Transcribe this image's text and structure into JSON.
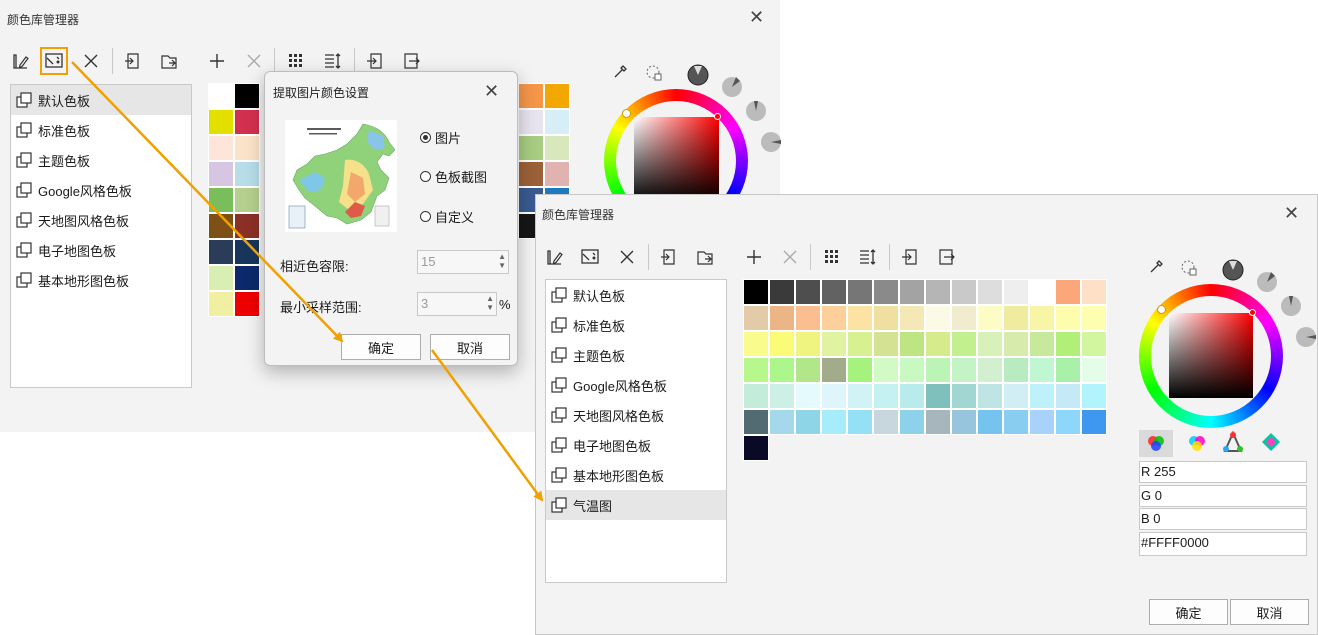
{
  "window1": {
    "title": "颜色库管理器",
    "close": "✕",
    "toolbar": [
      "edit",
      "extract-image",
      "delete",
      "import",
      "export",
      "add",
      "remove",
      "grid-view",
      "sort",
      "import-file",
      "export-file"
    ],
    "list": [
      {
        "label": "默认色板",
        "selected": true
      },
      {
        "label": "标准色板",
        "selected": false
      },
      {
        "label": "主题色板",
        "selected": false
      },
      {
        "label": "Google风格色板",
        "selected": false
      },
      {
        "label": "天地图风格色板",
        "selected": false
      },
      {
        "label": "电子地图色板",
        "selected": false
      },
      {
        "label": "基本地形图色板",
        "selected": false
      }
    ],
    "palette_left": [
      [
        "#ffffff",
        "#000000"
      ],
      [
        "#e3e000",
        "#d2304e"
      ],
      [
        "#fde6d9",
        "#fbe3c8"
      ],
      [
        "#d6c6e1",
        "#b6dde8"
      ],
      [
        "#79be5a",
        "#b4cf8e"
      ],
      [
        "#7d5016",
        "#8b3026"
      ],
      [
        "#2a3c58",
        "#18365c"
      ],
      [
        "#d8eeb2",
        "#0c2a6b"
      ],
      [
        "#f1efa2",
        "#ee0000"
      ]
    ],
    "palette_right": [
      [
        "#f59649",
        "#f2a800"
      ],
      [
        "#e7e3ef",
        "#d8eef6"
      ],
      [
        "#a7cc82",
        "#d9e8bc"
      ],
      [
        "#9b6138",
        "#e0b3b1"
      ],
      [
        "#395a90",
        "#1f79c0"
      ],
      [
        "#161616",
        "#bfbfbf"
      ]
    ]
  },
  "dialog": {
    "title": "提取图片颜色设置",
    "close": "✕",
    "options": [
      {
        "label": "图片",
        "selected": true
      },
      {
        "label": "色板截图",
        "selected": false
      },
      {
        "label": "自定义",
        "selected": false
      }
    ],
    "tolerance_label": "相近色容限:",
    "tolerance_value": "15",
    "sample_label": "最小采样范围:",
    "sample_value": "3",
    "sample_unit": "%",
    "ok": "确定",
    "cancel": "取消"
  },
  "window2": {
    "title": "颜色库管理器",
    "close": "✕",
    "list": [
      {
        "label": "默认色板",
        "selected": false
      },
      {
        "label": "标准色板",
        "selected": false
      },
      {
        "label": "主题色板",
        "selected": false
      },
      {
        "label": "Google风格色板",
        "selected": false
      },
      {
        "label": "天地图风格色板",
        "selected": false
      },
      {
        "label": "电子地图色板",
        "selected": false
      },
      {
        "label": "基本地形图色板",
        "selected": false
      },
      {
        "label": "气温图",
        "selected": true
      }
    ],
    "palette": [
      [
        "#000000",
        "#3a3a3a",
        "#4e4e4e",
        "#626262",
        "#767676",
        "#8a8a8a",
        "#a3a3a3",
        "#b5b5b5",
        "#c9c9c9",
        "#dddddd",
        "#eeeeee",
        "#ffffff",
        "#fca779",
        "#fde0c6"
      ],
      [
        "#e3caa9",
        "#ebb586",
        "#fbbe90",
        "#fdcf9a",
        "#fce3a3",
        "#efe0a1",
        "#f4e9b6",
        "#fbfae7",
        "#f0eccd",
        "#fdfbc6",
        "#efeb9f",
        "#f8f6a6",
        "#fdfdad",
        "#fefeb0"
      ],
      [
        "#f9fc8c",
        "#fafb77",
        "#eef47f",
        "#dff3a1",
        "#d7f191",
        "#d3e293",
        "#bde581",
        "#d6ec8c",
        "#c3f08f",
        "#d8f1b9",
        "#d7ebad",
        "#c7e99c",
        "#b2ef78",
        "#d2f6a0"
      ],
      [
        "#b7f78c",
        "#acf68c",
        "#b2e789",
        "#a2ab8a",
        "#a5f37d",
        "#d1fac5",
        "#c8f9c0",
        "#bcf4b6",
        "#c4f4c5",
        "#d2efcf",
        "#b9ebc1",
        "#c1f6d3",
        "#a9f1a8",
        "#e4fde8"
      ],
      [
        "#c4ecdb",
        "#cdf0e6",
        "#e4fafc",
        "#def5fb",
        "#d2f3f6",
        "#c6f1f2",
        "#b9ebec",
        "#7fbfbc",
        "#a2d6d2",
        "#bee4e4",
        "#d0eef4",
        "#bff1fb",
        "#c5e9f7",
        "#b2f4fe"
      ],
      [
        "#526b73",
        "#a6d8eb",
        "#8ed5e8",
        "#a6ecfd",
        "#94e0f4",
        "#c8d7dd",
        "#8ed1ea",
        "#a7b5bd",
        "#98c5de",
        "#74c4ed",
        "#89cdf1",
        "#a8d2f9",
        "#8ed6fa",
        "#3f98ef"
      ],
      [
        "#0a0a26"
      ]
    ],
    "rgb": {
      "r": "R 255",
      "g": "G 0",
      "b": "B 0",
      "hex": "#FFFF0000"
    },
    "ok": "确定",
    "cancel": "取消"
  },
  "colors": {
    "highlight": "#f0a000",
    "arrow": "#f0a000",
    "selected_color": "#ff0000"
  }
}
